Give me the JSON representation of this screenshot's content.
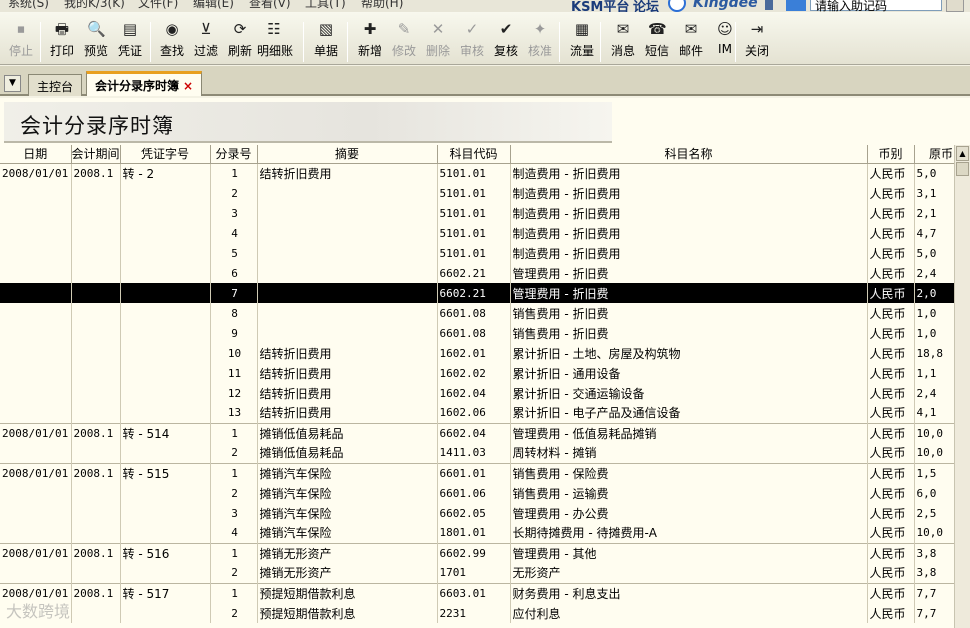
{
  "menu": {
    "items": [
      "系统(S)",
      "我的K/3(K)",
      "文件(F)",
      "编辑(E)",
      "查看(V)",
      "工具(T)",
      "帮助(H)"
    ],
    "ksm": "KSM平台",
    "forum": "论坛",
    "kingdee": "Kingdee",
    "help_placeholder": "请输入助记码"
  },
  "toolbar": [
    {
      "label": "停止",
      "icon": "stop-icon",
      "glyph": "⏹",
      "enabled": false
    },
    {
      "label": "打印",
      "icon": "printer-icon",
      "glyph": "🖶",
      "enabled": true
    },
    {
      "label": "预览",
      "icon": "preview-icon",
      "glyph": "🔍",
      "enabled": true
    },
    {
      "label": "凭证",
      "icon": "voucher-icon",
      "glyph": "▤",
      "enabled": true
    },
    {
      "label": "查找",
      "icon": "binoculars-icon",
      "glyph": "◉",
      "enabled": true
    },
    {
      "label": "过滤",
      "icon": "filter-icon",
      "glyph": "⊻",
      "enabled": true
    },
    {
      "label": "刷新",
      "icon": "refresh-icon",
      "glyph": "⟳",
      "enabled": true
    },
    {
      "label": "明细账",
      "icon": "ledger-icon",
      "glyph": "☷",
      "enabled": true
    },
    {
      "label": "单据",
      "icon": "document-icon",
      "glyph": "▧",
      "enabled": true
    },
    {
      "label": "新增",
      "icon": "new-icon",
      "glyph": "✚",
      "enabled": true
    },
    {
      "label": "修改",
      "icon": "edit-icon",
      "glyph": "✎",
      "enabled": false
    },
    {
      "label": "删除",
      "icon": "delete-icon",
      "glyph": "✕",
      "enabled": false
    },
    {
      "label": "审核",
      "icon": "audit-icon",
      "glyph": "✓",
      "enabled": false
    },
    {
      "label": "复核",
      "icon": "review-icon",
      "glyph": "✔",
      "enabled": true
    },
    {
      "label": "核准",
      "icon": "approve-icon",
      "glyph": "✦",
      "enabled": false
    },
    {
      "label": "流量",
      "icon": "flow-icon",
      "glyph": "▦",
      "enabled": true
    },
    {
      "label": "消息",
      "icon": "message-icon",
      "glyph": "✉",
      "enabled": true
    },
    {
      "label": "短信",
      "icon": "sms-icon",
      "glyph": "☎",
      "enabled": true
    },
    {
      "label": "邮件",
      "icon": "mail-icon",
      "glyph": "✉",
      "enabled": true
    },
    {
      "label": "IM",
      "icon": "im-icon",
      "glyph": "☺",
      "enabled": true
    },
    {
      "label": "关闭",
      "icon": "close-door-icon",
      "glyph": "⇥",
      "enabled": true
    }
  ],
  "tabs": [
    {
      "label": "主控台",
      "active": false
    },
    {
      "label": "会计分录序时簿",
      "active": true,
      "close": "×"
    }
  ],
  "page_title": "会计分录序时簿",
  "table": {
    "columns": [
      "日期",
      "会计期间",
      "凭证字号",
      "分录号",
      "摘要",
      "科目代码",
      "科目名称",
      "币别",
      "原币"
    ],
    "rows": [
      {
        "date": "2008/01/01",
        "period": "2008.1",
        "voucher": "转 - 2",
        "entry": "1",
        "summary": "结转折旧费用",
        "code": "5101.01",
        "account": "制造费用 - 折旧费用",
        "currency": "人民币",
        "amount": "5,0",
        "gs": true
      },
      {
        "date": "",
        "period": "",
        "voucher": "",
        "entry": "2",
        "summary": "",
        "code": "5101.01",
        "account": "制造费用 - 折旧费用",
        "currency": "人民币",
        "amount": "3,1"
      },
      {
        "date": "",
        "period": "",
        "voucher": "",
        "entry": "3",
        "summary": "",
        "code": "5101.01",
        "account": "制造费用 - 折旧费用",
        "currency": "人民币",
        "amount": "2,1"
      },
      {
        "date": "",
        "period": "",
        "voucher": "",
        "entry": "4",
        "summary": "",
        "code": "5101.01",
        "account": "制造费用 - 折旧费用",
        "currency": "人民币",
        "amount": "4,7"
      },
      {
        "date": "",
        "period": "",
        "voucher": "",
        "entry": "5",
        "summary": "",
        "code": "5101.01",
        "account": "制造费用 - 折旧费用",
        "currency": "人民币",
        "amount": "5,0"
      },
      {
        "date": "",
        "period": "",
        "voucher": "",
        "entry": "6",
        "summary": "",
        "code": "6602.21",
        "account": "管理费用 - 折旧费",
        "currency": "人民币",
        "amount": "2,4"
      },
      {
        "date": "",
        "period": "",
        "voucher": "",
        "entry": "7",
        "summary": "",
        "code": "6602.21",
        "account": "管理费用 - 折旧费",
        "currency": "人民币",
        "amount": "2,0",
        "sel": true
      },
      {
        "date": "",
        "period": "",
        "voucher": "",
        "entry": "8",
        "summary": "",
        "code": "6601.08",
        "account": "销售费用 - 折旧费",
        "currency": "人民币",
        "amount": "1,0"
      },
      {
        "date": "",
        "period": "",
        "voucher": "",
        "entry": "9",
        "summary": "",
        "code": "6601.08",
        "account": "销售费用 - 折旧费",
        "currency": "人民币",
        "amount": "1,0"
      },
      {
        "date": "",
        "period": "",
        "voucher": "",
        "entry": "10",
        "summary": "结转折旧费用",
        "code": "1602.01",
        "account": "累计折旧 - 土地、房屋及构筑物",
        "currency": "人民币",
        "amount": "18,8"
      },
      {
        "date": "",
        "period": "",
        "voucher": "",
        "entry": "11",
        "summary": "结转折旧费用",
        "code": "1602.02",
        "account": "累计折旧 - 通用设备",
        "currency": "人民币",
        "amount": "1,1"
      },
      {
        "date": "",
        "period": "",
        "voucher": "",
        "entry": "12",
        "summary": "结转折旧费用",
        "code": "1602.04",
        "account": "累计折旧 - 交通运输设备",
        "currency": "人民币",
        "amount": "2,4"
      },
      {
        "date": "",
        "period": "",
        "voucher": "",
        "entry": "13",
        "summary": "结转折旧费用",
        "code": "1602.06",
        "account": "累计折旧 - 电子产品及通信设备",
        "currency": "人民币",
        "amount": "4,1"
      },
      {
        "date": "2008/01/01",
        "period": "2008.1",
        "voucher": "转 - 514",
        "entry": "1",
        "summary": "摊销低值易耗品",
        "code": "6602.04",
        "account": "管理费用 - 低值易耗品摊销",
        "currency": "人民币",
        "amount": "10,0",
        "gs": true
      },
      {
        "date": "",
        "period": "",
        "voucher": "",
        "entry": "2",
        "summary": "摊销低值易耗品",
        "code": "1411.03",
        "account": "周转材料 - 摊销",
        "currency": "人民币",
        "amount": "10,0"
      },
      {
        "date": "2008/01/01",
        "period": "2008.1",
        "voucher": "转 - 515",
        "entry": "1",
        "summary": "摊销汽车保险",
        "code": "6601.01",
        "account": "销售费用 - 保险费",
        "currency": "人民币",
        "amount": "1,5",
        "gs": true
      },
      {
        "date": "",
        "period": "",
        "voucher": "",
        "entry": "2",
        "summary": "摊销汽车保险",
        "code": "6601.06",
        "account": "销售费用 - 运输费",
        "currency": "人民币",
        "amount": "6,0"
      },
      {
        "date": "",
        "period": "",
        "voucher": "",
        "entry": "3",
        "summary": "摊销汽车保险",
        "code": "6602.05",
        "account": "管理费用 - 办公费",
        "currency": "人民币",
        "amount": "2,5"
      },
      {
        "date": "",
        "period": "",
        "voucher": "",
        "entry": "4",
        "summary": "摊销汽车保险",
        "code": "1801.01",
        "account": "长期待摊费用 - 待摊费用-A",
        "currency": "人民币",
        "amount": "10,0"
      },
      {
        "date": "2008/01/01",
        "period": "2008.1",
        "voucher": "转 - 516",
        "entry": "1",
        "summary": "摊销无形资产",
        "code": "6602.99",
        "account": "管理费用 - 其他",
        "currency": "人民币",
        "amount": "3,8",
        "gs": true
      },
      {
        "date": "",
        "period": "",
        "voucher": "",
        "entry": "2",
        "summary": "摊销无形资产",
        "code": "1701",
        "account": "无形资产",
        "currency": "人民币",
        "amount": "3,8"
      },
      {
        "date": "2008/01/01",
        "period": "2008.1",
        "voucher": "转 - 517",
        "entry": "1",
        "summary": "预提短期借款利息",
        "code": "6603.01",
        "account": "财务费用 - 利息支出",
        "currency": "人民币",
        "amount": "7,7",
        "gs": true
      },
      {
        "date": "",
        "period": "",
        "voucher": "",
        "entry": "2",
        "summary": "预提短期借款利息",
        "code": "2231",
        "account": "应付利息",
        "currency": "人民币",
        "amount": "7,7"
      }
    ]
  },
  "watermark": "大数跨境"
}
